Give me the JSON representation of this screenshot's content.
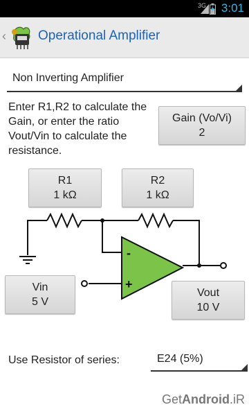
{
  "status_bar": {
    "network": "3G",
    "time": "3:01"
  },
  "action_bar": {
    "title": "Operational Amplifier"
  },
  "mode_spinner": {
    "selected": "Non Inverting Amplifier"
  },
  "instructions": "Enter R1,R2 to calculate the Gain, or enter the ratio Vout/Vin to calculate the resistance.",
  "gain_button": {
    "label": "Gain (Vo/Vi)",
    "value": "2"
  },
  "r1_button": {
    "label": "R1",
    "value": "1 kΩ"
  },
  "r2_button": {
    "label": "R2",
    "value": "1 kΩ"
  },
  "vin_button": {
    "label": "Vin",
    "value": "5 V"
  },
  "vout_button": {
    "label": "Vout",
    "value": "10 V"
  },
  "opamp": {
    "minus_sign": "-",
    "plus_sign": "+",
    "fill_color": "#7cc34a"
  },
  "series": {
    "label": "Use Resistor of series:",
    "selected": "E24 (5%)"
  },
  "watermark": {
    "prefix": "Get",
    "brand": "Android",
    "suffix": ".iR"
  }
}
